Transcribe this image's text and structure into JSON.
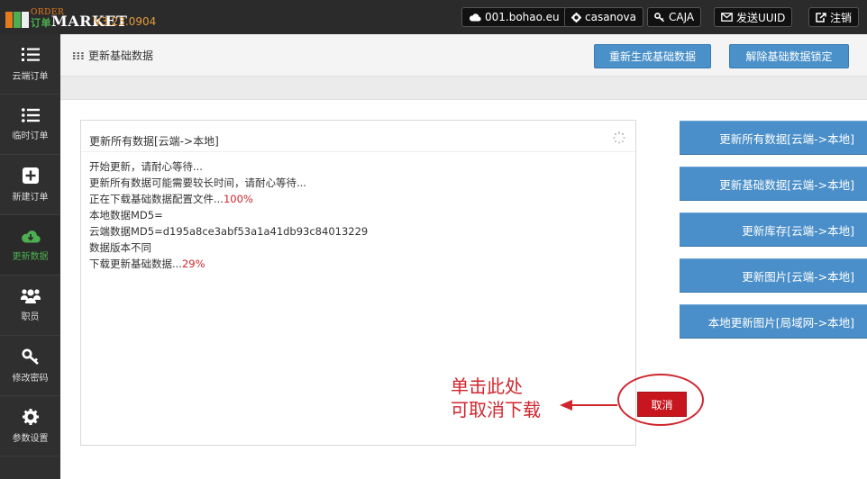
{
  "app": {
    "logo_top": "ORDER",
    "logo_main": "MARKET",
    "logo_cn": "订单",
    "version": "V3.23.0904"
  },
  "topbar": {
    "server": "001.bohao.eu",
    "user": "casanova",
    "key": "CAJA",
    "send_uuid": "发送UUID",
    "logout": "注销"
  },
  "sidebar": {
    "items": [
      {
        "label": "云端订单",
        "icon": "list-ordered-icon"
      },
      {
        "label": "临时订单",
        "icon": "list-icon"
      },
      {
        "label": "新建订单",
        "icon": "plus-square-icon"
      },
      {
        "label": "更新数据",
        "icon": "cloud-download-icon",
        "active": true
      },
      {
        "label": "职员",
        "icon": "users-icon"
      },
      {
        "label": "修改密码",
        "icon": "key-icon"
      },
      {
        "label": "参数设置",
        "icon": "gear-icon"
      }
    ]
  },
  "header": {
    "title": "更新基础数据",
    "btn_regenerate": "重新生成基础数据",
    "btn_unlock": "解除基础数据锁定"
  },
  "panel": {
    "title": "更新所有数据[云端->本地]",
    "lines": {
      "l1": "开始更新，请耐心等待...",
      "l2": "更新所有数据可能需要较长时间，请耐心等待...",
      "l3": "正在下载基础数据配置文件...",
      "l3_pct": "100%",
      "l4": "本地数据MD5=",
      "l5": "云端数据MD5=d195a8ce3abf53a1a41db93c84013229",
      "l6": "数据版本不同",
      "l7": "下载更新基础数据...",
      "l7_pct": "29%"
    }
  },
  "actions": {
    "a1": "更新所有数据[云端->本地]",
    "a2": "更新基础数据[云端->本地]",
    "a3": "更新库存[云端->本地]",
    "a4": "更新图片[云端->本地]",
    "a5": "本地更新图片[局域网->本地]"
  },
  "cancel": {
    "label": "取消",
    "annotation_line1": "单击此处",
    "annotation_line2": "可取消下载"
  },
  "colors": {
    "accent_blue": "#4a8fc9",
    "cancel_red": "#c8161e",
    "active_green": "#4caf50"
  }
}
